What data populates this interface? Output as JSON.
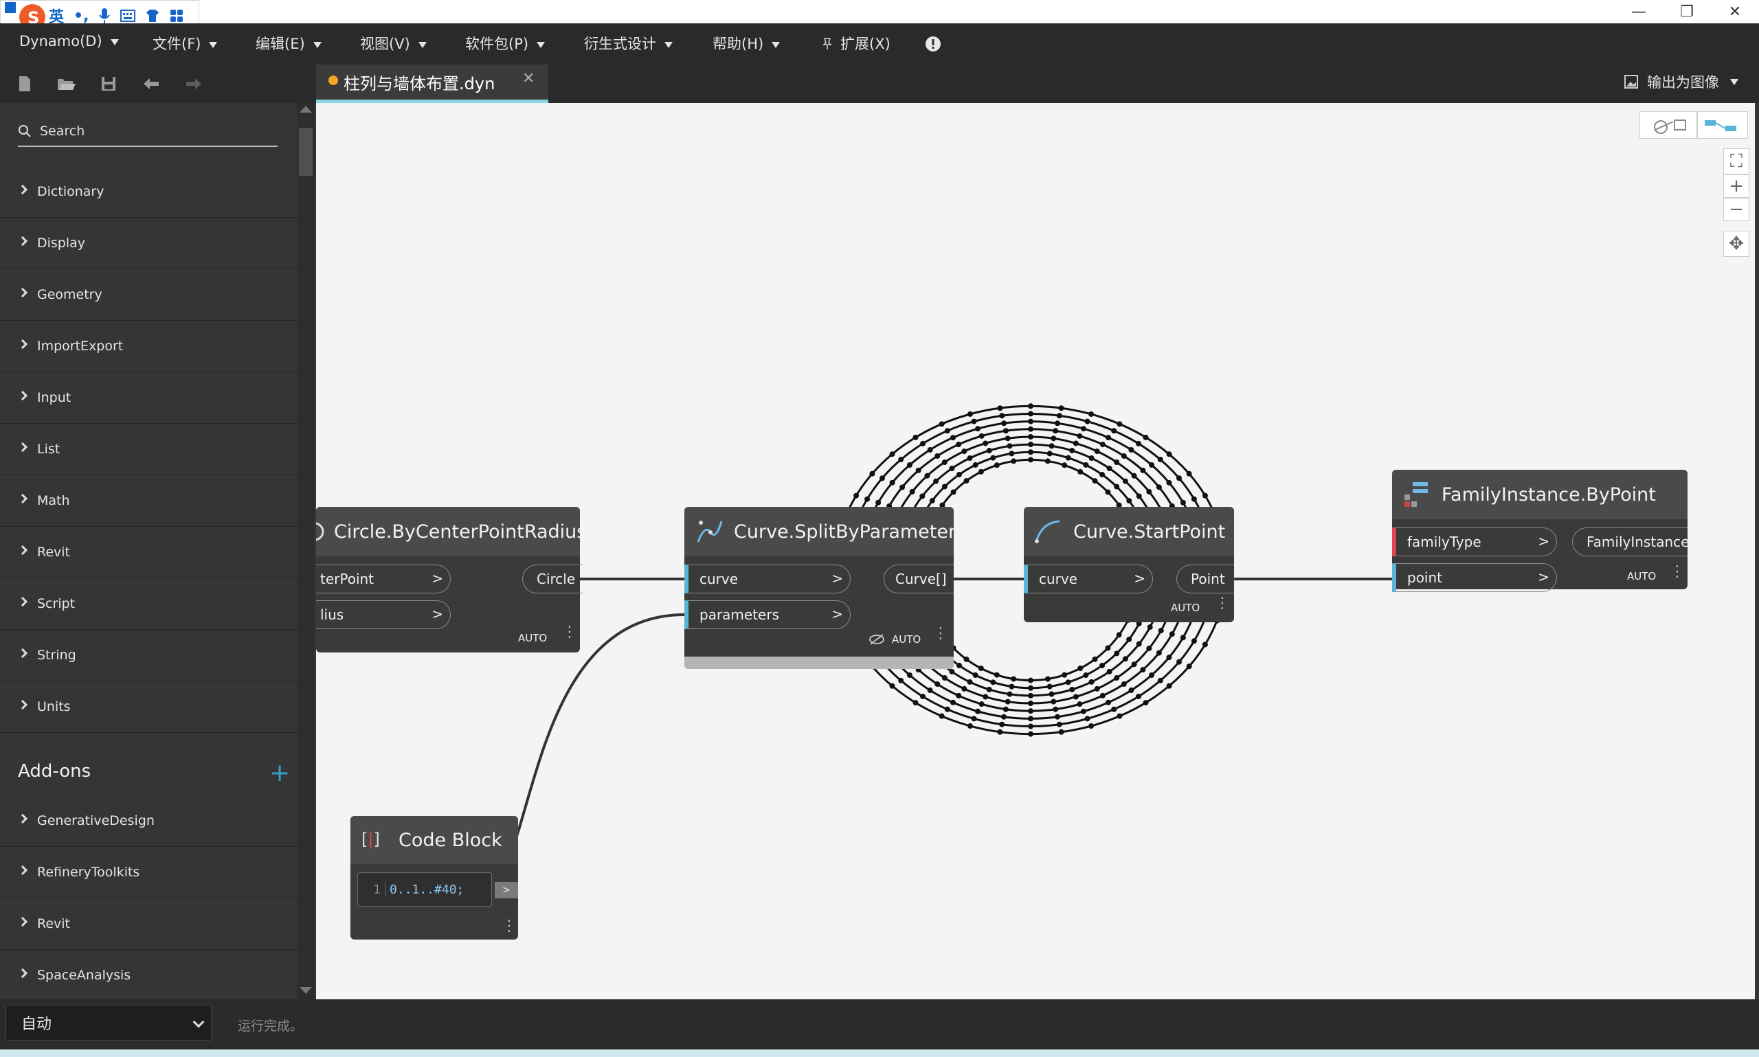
{
  "ime": {
    "mode": "英",
    "punct": "•,"
  },
  "menu": {
    "dynamo": "Dynamo(D)",
    "file": "文件(F)",
    "edit": "编辑(E)",
    "view": "视图(V)",
    "packages": "软件包(P)",
    "generative": "衍生式设计",
    "help": "帮助(H)",
    "extensions": "扩展(X)"
  },
  "tab": {
    "title": "柱列与墙体布置.dyn",
    "modified": true
  },
  "export_label": "输出为图像",
  "library": {
    "search_placeholder": "Search",
    "categories": [
      "Dictionary",
      "Display",
      "Geometry",
      "ImportExport",
      "Input",
      "List",
      "Math",
      "Revit",
      "Script",
      "String",
      "Units"
    ],
    "addons_title": "Add-ons",
    "addons": [
      "GenerativeDesign",
      "RefineryToolkits",
      "Revit",
      "SpaceAnalysis"
    ]
  },
  "nodes": {
    "circle": {
      "title": "Circle.ByCenterPointRadius",
      "in1": "terPoint",
      "in2": "lius",
      "out": "Circle",
      "lacing": "AUTO"
    },
    "split": {
      "title": "Curve.SplitByParameter",
      "in1": "curve",
      "in2": "parameters",
      "out": "Curve[]",
      "lacing": "AUTO"
    },
    "start": {
      "title": "Curve.StartPoint",
      "in1": "curve",
      "out": "Point",
      "lacing": "AUTO"
    },
    "family": {
      "title": "FamilyInstance.ByPoint",
      "in1": "familyType",
      "in2": "point",
      "out": "FamilyInstance",
      "lacing": "AUTO"
    },
    "code": {
      "title": "Code Block",
      "line": "1",
      "code": "0..1..#40;"
    }
  },
  "status": {
    "run_mode": "自动",
    "message": "运行完成。"
  },
  "colors": {
    "accent": "#5ab4d8",
    "tab_underline": "#8ad3e0",
    "modified_dot": "#f5a623",
    "required_port": "#e0464e",
    "addon_plus": "#35a2c3"
  }
}
